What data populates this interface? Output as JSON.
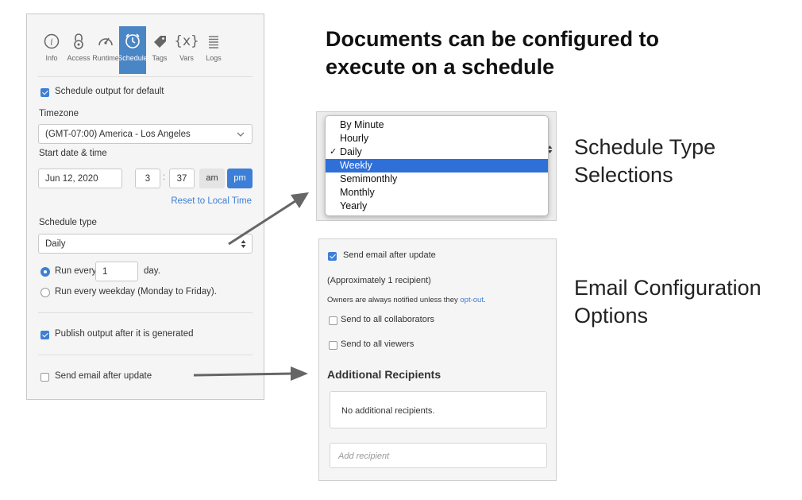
{
  "panel": {
    "tabs": [
      {
        "label": "Info",
        "icon": "info-icon"
      },
      {
        "label": "Access",
        "icon": "lock-icon"
      },
      {
        "label": "Runtime",
        "icon": "gauge-icon"
      },
      {
        "label": "Schedule",
        "icon": "clock-icon",
        "active": true
      },
      {
        "label": "Tags",
        "icon": "tag-icon"
      },
      {
        "label": "Vars",
        "icon": "variables-icon",
        "glyph": "{x}"
      },
      {
        "label": "Logs",
        "icon": "logs-icon"
      }
    ],
    "schedule_output_label": "Schedule output for default",
    "timezone_label": "Timezone",
    "timezone_value": "(GMT-07:00) America - Los Angeles",
    "start_label": "Start date & time",
    "date_value": "Jun 12, 2020",
    "hour_value": "3",
    "time_sep": ":",
    "minute_value": "37",
    "am_label": "am",
    "pm_label": "pm",
    "reset_link": "Reset to Local Time",
    "schedule_type_label": "Schedule type",
    "schedule_type_value": "Daily",
    "run_every_prefix": "Run every",
    "run_every_value": "1",
    "run_every_suffix": "day.",
    "run_weekday_label": "Run every weekday (Monday to Friday).",
    "publish_label": "Publish output after it is generated",
    "send_email_label": "Send email after update"
  },
  "headline": [
    "Documents can be configured to",
    "execute on a schedule"
  ],
  "schedule_menu": {
    "items": [
      "By Minute",
      "Hourly",
      "Daily",
      "Weekly",
      "Semimonthly",
      "Monthly",
      "Yearly"
    ],
    "checked_index": 2,
    "highlighted_index": 3,
    "check_glyph": "✓"
  },
  "caption_schedule": [
    "Schedule Type",
    "Selections"
  ],
  "email": {
    "send_email_label": "Send email after update",
    "recipient_count": "(Approximately 1 recipient)",
    "owners_note": "Owners are always notified unless they",
    "opt_out_link": "opt-out",
    "owners_note_end": ".",
    "collaborators_label": "Send to all collaborators",
    "viewers_label": "Send to all viewers",
    "additional_heading": "Additional Recipients",
    "no_recipients": "No additional recipients.",
    "add_placeholder": "Add recipient"
  },
  "caption_email": [
    "Email Configuration",
    "Options"
  ],
  "colors": {
    "accent": "#3d7fd6",
    "tab_active": "#4a86c5",
    "menu_highlight": "#2f6fd8",
    "arrow": "#666666"
  }
}
